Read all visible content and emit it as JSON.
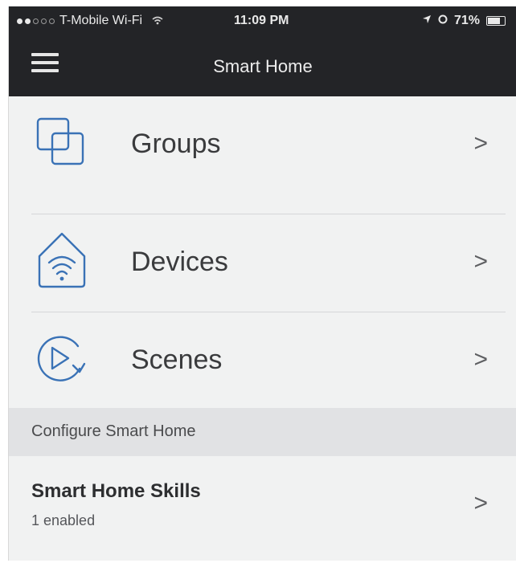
{
  "status_bar": {
    "carrier": "T-Mobile Wi-Fi",
    "time": "11:09 PM",
    "battery": "71%",
    "signal_dots_filled": 2,
    "signal_dots_total": 5
  },
  "nav": {
    "title": "Smart Home",
    "menu_icon": "hamburger-menu-icon"
  },
  "rows": [
    {
      "label": "Groups",
      "icon": "groups-icon"
    },
    {
      "label": "Devices",
      "icon": "devices-home-wifi-icon"
    },
    {
      "label": "Scenes",
      "icon": "scenes-play-icon"
    }
  ],
  "section": {
    "header": "Configure Smart Home"
  },
  "skills": {
    "title": "Smart Home Skills",
    "subtitle": "1 enabled"
  },
  "chevron": ">",
  "colors": {
    "bar_bg": "#232427",
    "body_bg": "#f1f2f2",
    "icon_blue": "#3a72b6",
    "section_bg": "#e1e2e4"
  }
}
